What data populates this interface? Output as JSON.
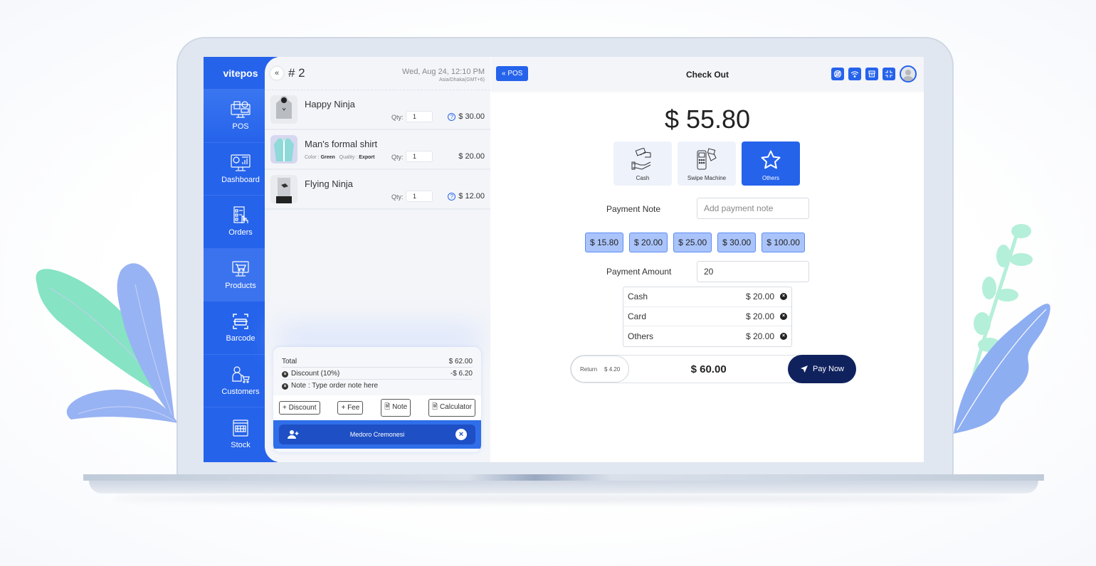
{
  "app": {
    "logo": "vitepos"
  },
  "sidebar": {
    "items": [
      {
        "label": "POS",
        "icon": "pos-terminal-icon",
        "active": true
      },
      {
        "label": "Dashboard",
        "icon": "dashboard-chart-icon"
      },
      {
        "label": "Orders",
        "icon": "orders-list-icon"
      },
      {
        "label": "Products",
        "icon": "products-cart-icon"
      },
      {
        "label": "Barcode",
        "icon": "barcode-scan-icon"
      },
      {
        "label": "Customers",
        "icon": "customer-icon"
      },
      {
        "label": "Stock",
        "icon": "stock-box-icon"
      }
    ]
  },
  "cart": {
    "collapse_icon": "«",
    "order_number": "# 2",
    "date": "Wed, Aug 24, 12:10 PM",
    "timezone": "Asia/Dhaka(GMT+6)",
    "qty_label": "Qty:",
    "items": [
      {
        "name": "Happy Ninja",
        "qty": "1",
        "price": "$ 30.00",
        "help": true,
        "attrs": null
      },
      {
        "name": "Man's formal shirt",
        "qty": "1",
        "price": "$ 20.00",
        "help": false,
        "attrs": {
          "color_label": "Color :",
          "color": "Green",
          "quality_label": "Quality :",
          "quality": "Export"
        }
      },
      {
        "name": "Flying Ninja",
        "qty": "1",
        "price": "$ 12.00",
        "help": true,
        "attrs": null
      }
    ],
    "summary": {
      "total_label": "Total",
      "total": "$ 62.00",
      "discount_label": "Discount (10%)",
      "discount": "-$ 6.20",
      "note_label": "Note : Type order note here"
    },
    "buttons": {
      "discount": "+ Discount",
      "fee": "+ Fee",
      "note": "Note",
      "calculator": "Calculator"
    },
    "customer": "Medoro Cremonesi"
  },
  "checkout": {
    "back_label": "« POS",
    "title": "Check Out",
    "header_icons": [
      "sync-icon",
      "wifi-icon",
      "store-icon",
      "compress-icon"
    ],
    "amount": "$ 55.80",
    "methods": [
      {
        "label": "Cash",
        "selected": false
      },
      {
        "label": "Swipe Machine",
        "selected": false
      },
      {
        "label": "Others",
        "selected": true
      }
    ],
    "payment_note_label": "Payment Note",
    "payment_note_placeholder": "Add payment note",
    "quick_amounts": [
      "$ 15.80",
      "$ 20.00",
      "$ 25.00",
      "$ 30.00",
      "$ 100.00"
    ],
    "payment_amount_label": "Payment Amount",
    "payment_amount_value": "20",
    "splits": [
      {
        "method": "Cash",
        "amount": "$ 20.00"
      },
      {
        "method": "Card",
        "amount": "$ 20.00"
      },
      {
        "method": "Others",
        "amount": "$ 20.00"
      }
    ],
    "return_label": "Return",
    "return_amount": "$ 4.20",
    "paid_total": "$ 60.00",
    "pay_now": "Pay Now"
  },
  "colors": {
    "primary": "#2563eb",
    "pay_button": "#10225e",
    "quick_button": "#aac4fb"
  }
}
